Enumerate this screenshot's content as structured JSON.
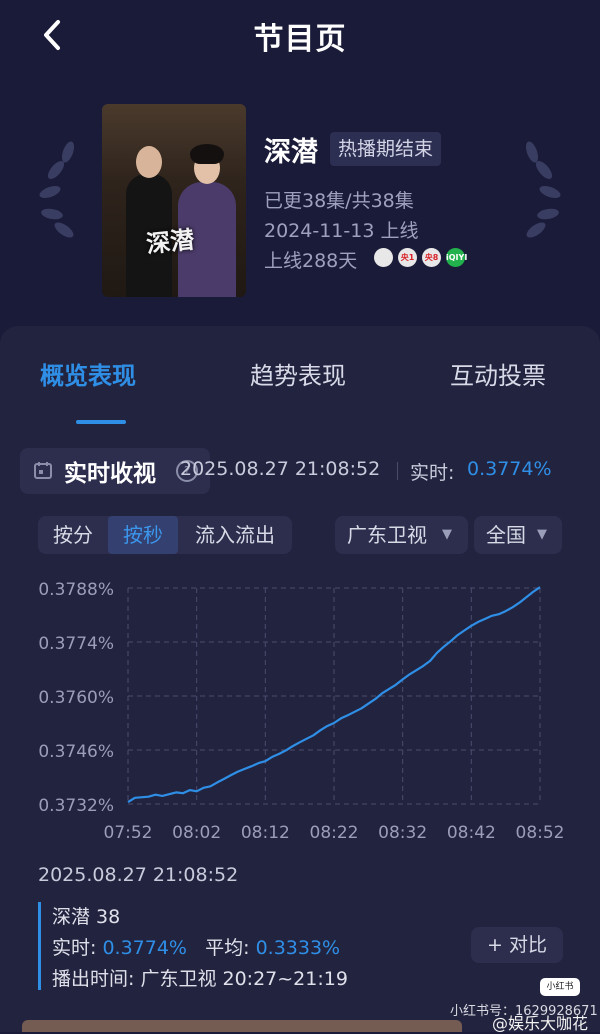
{
  "header": {
    "title": "节目页",
    "back_icon": "chevron-left-icon"
  },
  "show": {
    "poster_title": "深潜",
    "name": "深潜",
    "status": "热播期结束",
    "episodes": "已更38集/共38集",
    "premiere": "2024-11-13 上线",
    "days_online": "上线288天",
    "platform_logos": [
      "广东卫视",
      "央1",
      "央8",
      "iQIYI"
    ],
    "platform_logo_text": [
      "",
      "央1",
      "央8",
      "iQIYI"
    ]
  },
  "tabs": [
    "概览表现",
    "趋势表现",
    "互动投票"
  ],
  "realtime": {
    "title": "实时收视",
    "timestamp": "2025.08.27 21:08:52",
    "label": "实时:",
    "value": "0.3774%"
  },
  "controls": {
    "segments": [
      "按分",
      "按秒",
      "流入流出"
    ],
    "active_segment": "按秒",
    "channel": "广东卫视",
    "region": "全国"
  },
  "chart_data": {
    "type": "line",
    "x_ticks": [
      "07:52",
      "08:02",
      "08:12",
      "08:22",
      "08:32",
      "08:42",
      "08:52"
    ],
    "y_ticks": [
      "0.3788%",
      "0.3774%",
      "0.3760%",
      "0.3746%",
      "0.3732%"
    ],
    "ylim": [
      0.3732,
      0.3788
    ],
    "grid": true,
    "line_color": "#2f8fe6",
    "series": [
      {
        "x": [
          0,
          1,
          3,
          4,
          5,
          7,
          8,
          9,
          10,
          11,
          12,
          13,
          14,
          15,
          16,
          17,
          18,
          19,
          20,
          21,
          22,
          23,
          24,
          25,
          26,
          27,
          28,
          29,
          30,
          31,
          32,
          33,
          34,
          35,
          36,
          37,
          38,
          39,
          40,
          41,
          42,
          43,
          44,
          45,
          46,
          47,
          48,
          49,
          50,
          51,
          52,
          53,
          54,
          55,
          56,
          57,
          58,
          59,
          60
        ],
        "y": [
          0.37325,
          0.37336,
          0.37339,
          0.37344,
          0.37341,
          0.3735,
          0.37348,
          0.37356,
          0.37353,
          0.37362,
          0.37366,
          0.37376,
          0.37385,
          0.37395,
          0.37404,
          0.37411,
          0.37418,
          0.37426,
          0.37431,
          0.37442,
          0.3745,
          0.37459,
          0.3747,
          0.3748,
          0.37489,
          0.37498,
          0.37511,
          0.37522,
          0.3753,
          0.37542,
          0.3755,
          0.37559,
          0.37568,
          0.3758,
          0.37592,
          0.37607,
          0.37618,
          0.37629,
          0.37643,
          0.37656,
          0.37667,
          0.37678,
          0.37691,
          0.37712,
          0.37728,
          0.37742,
          0.37758,
          0.3777,
          0.37782,
          0.37792,
          0.378,
          0.37808,
          0.37812,
          0.3782,
          0.3783,
          0.37842,
          0.37856,
          0.3787,
          0.37882
        ]
      }
    ]
  },
  "detail": {
    "timestamp": "2025.08.27 21:08:52",
    "series_name": "深潜 38",
    "realtime_label": "实时:",
    "realtime_value": "0.3774%",
    "average_label": "平均:",
    "average_value": "0.3333%",
    "airtime_label": "播出时间:",
    "airtime_value": "广东卫视 20:27~21:19",
    "compare_button": "+ 对比"
  },
  "watermark": {
    "badge": "小红书",
    "text": "小红书号：1629928671",
    "weibo": "@娱乐大咖花"
  }
}
